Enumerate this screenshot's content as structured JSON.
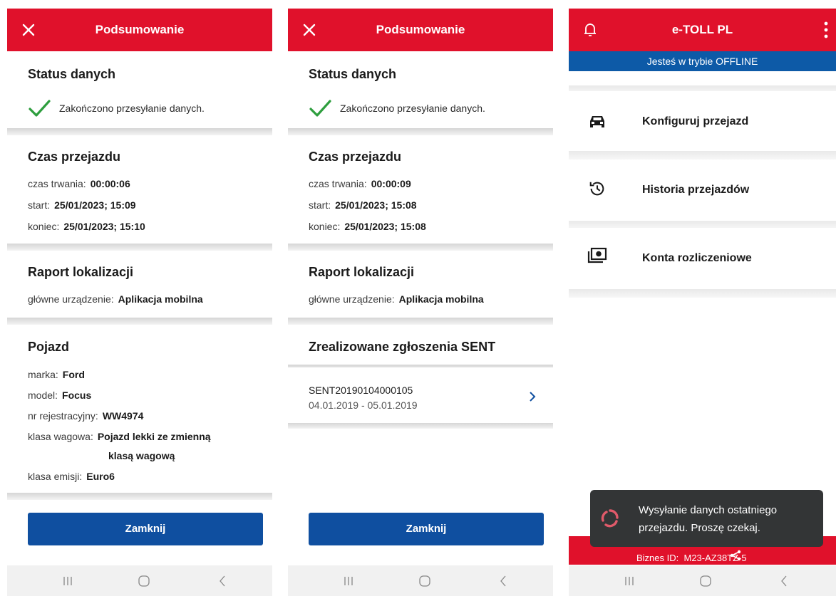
{
  "screen1": {
    "title": "Podsumowanie",
    "status": {
      "heading": "Status danych",
      "text": "Zakończono przesyłanie danych."
    },
    "time": {
      "heading": "Czas przejazdu",
      "duration_label": "czas trwania:",
      "duration": "00:00:06",
      "start_label": "start:",
      "start": "25/01/2023; 15:09",
      "end_label": "koniec:",
      "end": "25/01/2023; 15:10"
    },
    "location": {
      "heading": "Raport lokalizacji",
      "device_label": "główne urządzenie:",
      "device": "Aplikacja mobilna"
    },
    "vehicle": {
      "heading": "Pojazd",
      "make_label": "marka:",
      "make": "Ford",
      "model_label": "model:",
      "model": "Focus",
      "reg_label": "nr rejestracyjny:",
      "reg": "WW4974",
      "weight_label": "klasa wagowa:",
      "weight_line1": "Pojazd lekki ze zmienną",
      "weight_line2": "klasą wagową",
      "emission_label": "klasa emisji:",
      "emission": "Euro6"
    },
    "close_button": "Zamknij"
  },
  "screen2": {
    "title": "Podsumowanie",
    "status": {
      "heading": "Status danych",
      "text": "Zakończono przesyłanie danych."
    },
    "time": {
      "heading": "Czas przejazdu",
      "duration_label": "czas trwania:",
      "duration": "00:00:09",
      "start_label": "start:",
      "start": "25/01/2023; 15:08",
      "end_label": "koniec:",
      "end": "25/01/2023; 15:08"
    },
    "location": {
      "heading": "Raport lokalizacji",
      "device_label": "główne urządzenie:",
      "device": "Aplikacja mobilna"
    },
    "sent": {
      "heading": "Zrealizowane zgłoszenia SENT",
      "code": "SENT20190104000105",
      "dates": "04.01.2019 - 05.01.2019"
    },
    "close_button": "Zamknij"
  },
  "screen3": {
    "title": "e-TOLL PL",
    "offline_banner": "Jesteś w trybie OFFLINE",
    "menu": [
      {
        "label": "Konfiguruj przejazd",
        "icon": "car-icon"
      },
      {
        "label": "Historia przejazdów",
        "icon": "history-icon"
      },
      {
        "label": "Konta rozliczeniowe",
        "icon": "money-icon"
      }
    ],
    "toast": "Wysyłanie danych ostatniego przejazdu. Proszę czekaj.",
    "business_id_label": "Biznes ID:",
    "business_id": "M23-AZ38TZ-5"
  },
  "colors": {
    "brand_red": "#e0112b",
    "primary_blue": "#0f4fa0",
    "offline_blue": "#0d5aa7",
    "check_green": "#2e9e3e"
  }
}
